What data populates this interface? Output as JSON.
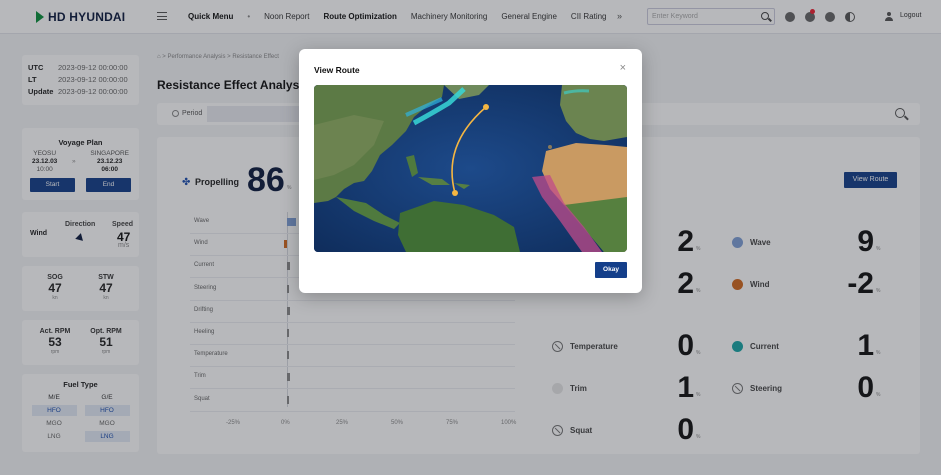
{
  "header": {
    "logo_text": "HD HYUNDAI",
    "nav": [
      {
        "label": "Quick Menu",
        "variant": "quick"
      },
      {
        "label": "•",
        "variant": "sep"
      },
      {
        "label": "Noon Report",
        "variant": ""
      },
      {
        "label": "Route Optimization",
        "variant": "active"
      },
      {
        "label": "Machinery Monitoring",
        "variant": ""
      },
      {
        "label": "General Engine",
        "variant": ""
      },
      {
        "label": "CII Rating",
        "variant": ""
      }
    ],
    "more": "»",
    "search_placeholder": "Enter Keyword",
    "logout": "Logout"
  },
  "time": {
    "rows": [
      {
        "k": "UTC",
        "v": "2023-09-12 00:00:00"
      },
      {
        "k": "LT",
        "v": "2023-09-12 00:00:00"
      },
      {
        "k": "Update",
        "v": "2023-09-12 00:00:00"
      }
    ]
  },
  "voyage": {
    "title": "Voyage Plan",
    "from": {
      "port": "YEOSU",
      "date": "23.12.03",
      "time": "10:00"
    },
    "to": {
      "port": "SINGAPORE",
      "date": "23.12.23",
      "time": "06:00"
    },
    "start": "Start",
    "end": "End"
  },
  "wind": {
    "label": "Wind",
    "direction_label": "Direction",
    "speed_label": "Speed",
    "speed": "47",
    "speed_unit": "m/s"
  },
  "sog": {
    "label": "SOG",
    "value": "47",
    "unit": "kn"
  },
  "stw": {
    "label": "STW",
    "value": "47",
    "unit": "kn"
  },
  "act_rpm": {
    "label": "Act. RPM",
    "value": "53",
    "unit": "rpm"
  },
  "opt_rpm": {
    "label": "Opt. RPM",
    "value": "51",
    "unit": "rpm"
  },
  "fuel": {
    "title": "Fuel Type",
    "me_label": "M/E",
    "ge_label": "G/E",
    "me": [
      "HFO",
      "MGO",
      "LNG"
    ],
    "ge": [
      "HFO",
      "MGO",
      "LNG"
    ],
    "me_selected": [
      "HFO"
    ],
    "ge_selected": [
      "HFO",
      "LNG"
    ]
  },
  "page": {
    "breadcrumb": "⌂  >  Performance Analysis  >  Resistance Effect",
    "title": "Resistance Effect Analysis",
    "period_label": "Period",
    "propelling_label": "Propelling",
    "propelling_value": "86",
    "propelling_unit": "%",
    "view_route": "View Route"
  },
  "chart_data": {
    "type": "bar",
    "orientation": "horizontal",
    "categories": [
      "Wave",
      "Wind",
      "Current",
      "Steering",
      "Drifting",
      "Heeling",
      "Temperature",
      "Trim",
      "Squat"
    ],
    "values": [
      9,
      -2,
      1,
      0,
      1,
      0,
      0,
      1,
      0
    ],
    "colors": [
      "#7f9fd6",
      "#d2691e",
      "#8a8a8a",
      "#8a8a8a",
      "#8a8a8a",
      "#8a8a8a",
      "#8a8a8a",
      "#8a8a8a",
      "#8a8a8a"
    ],
    "xlim": [
      -25,
      100
    ],
    "xticks": [
      "-25%",
      "0%",
      "25%",
      "50%",
      "75%",
      "100%"
    ]
  },
  "factors": [
    {
      "label": "Wave",
      "value": "9",
      "unit": "%",
      "color": "#7f9fd6"
    },
    {
      "label": "Wind",
      "value": "-2",
      "unit": "%",
      "color": "#d2691e"
    },
    {
      "label": "Temperature",
      "value": "0",
      "unit": "%",
      "color": "ban"
    },
    {
      "label": "Current",
      "value": "1",
      "unit": "%",
      "color": "#1aa6a6"
    },
    {
      "label": "Trim",
      "value": "1",
      "unit": "%",
      "color": "#e6e6e6"
    },
    {
      "label": "Steering",
      "value": "0",
      "unit": "%",
      "color": "ban"
    },
    {
      "label": "Squat",
      "value": "0",
      "unit": "%",
      "color": "ban"
    }
  ],
  "hidden_values": [
    "2",
    "2"
  ],
  "modal": {
    "title": "View Route",
    "close": "×",
    "ok": "Okay"
  }
}
